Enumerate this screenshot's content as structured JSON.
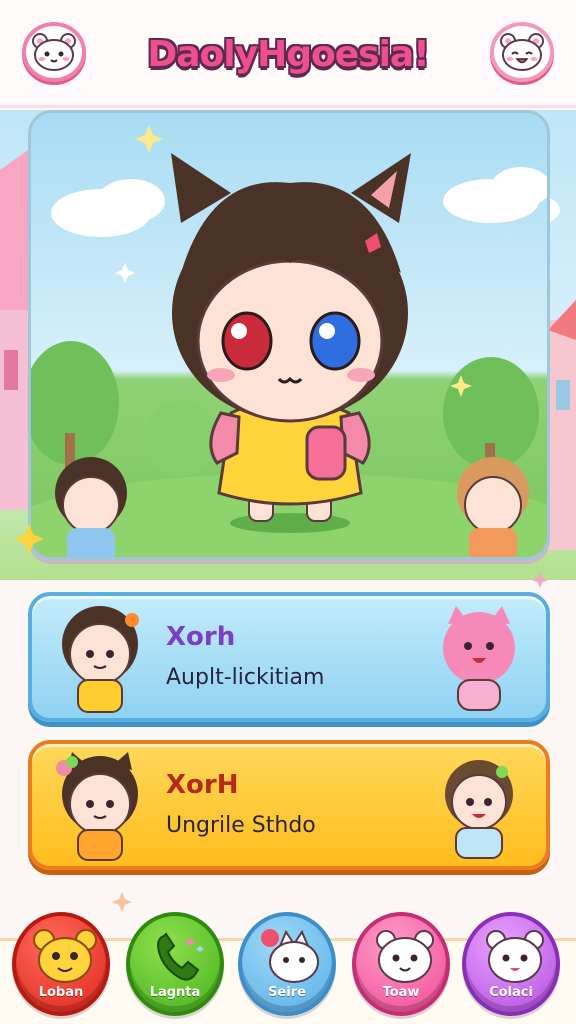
{
  "app": {
    "title": "DaolyHgoesia!"
  },
  "header": {
    "left_avatar_icon": "white-bear-face-icon",
    "right_avatar_icon": "white-bear-face-icon"
  },
  "hero": {
    "main_character": "chibi-cat-ear-girl",
    "left_character": "chibi-boy",
    "right_character": "chibi-girl-blonde"
  },
  "cards": [
    {
      "name": "Xorh",
      "subtitle": "Auplt-lickitiam",
      "color": "#8fd2f2",
      "deco_icon": "pink-cat-icon"
    },
    {
      "name": "XorH",
      "subtitle": "Ungrile Sthdo",
      "color": "#ffc62e",
      "deco_icon": "chibi-boy-icon"
    }
  ],
  "nav": [
    {
      "label": "Loban",
      "icon": "yellow-bear-icon",
      "color": "#e0251c"
    },
    {
      "label": "Lagnta",
      "icon": "phone-icon",
      "color": "#46b21c"
    },
    {
      "label": "Seire",
      "icon": "white-cat-icon",
      "color": "#57aee8"
    },
    {
      "label": "Toaw",
      "icon": "white-bear-icon",
      "color": "#f04b94"
    },
    {
      "label": "Colaci",
      "icon": "white-bear-icon",
      "color": "#b24be0"
    }
  ]
}
